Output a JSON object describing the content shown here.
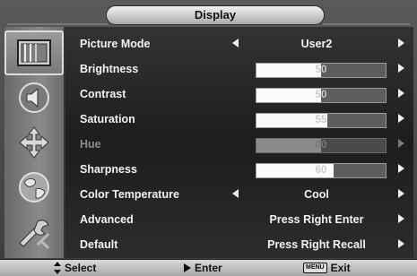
{
  "header": {
    "title": "Display"
  },
  "sidebar": {
    "icons": [
      {
        "name": "display-icon",
        "selected": true
      },
      {
        "name": "audio-icon",
        "selected": false
      },
      {
        "name": "position-icon",
        "selected": false
      },
      {
        "name": "globe-icon",
        "selected": false
      },
      {
        "name": "tools-icon",
        "selected": false
      }
    ]
  },
  "menu": {
    "picture_mode": {
      "label": "Picture Mode",
      "value": "User2"
    },
    "brightness": {
      "label": "Brightness",
      "value": "50",
      "level": 0.5
    },
    "contrast": {
      "label": "Contrast",
      "value": "50",
      "level": 0.5
    },
    "saturation": {
      "label": "Saturation",
      "value": "55",
      "level": 0.55
    },
    "hue": {
      "label": "Hue",
      "value": "00",
      "level": 0.5
    },
    "sharpness": {
      "label": "Sharpness",
      "value": "60",
      "level": 0.6
    },
    "color_temperature": {
      "label": "Color Temperature",
      "value": "Cool"
    },
    "advanced": {
      "label": "Advanced",
      "value": "Press Right Enter"
    },
    "default": {
      "label": "Default",
      "value": "Press Right Recall"
    }
  },
  "footer": {
    "select_label": "Select",
    "enter_label": "Enter",
    "menu_key": "MENU",
    "exit_label": "Exit"
  },
  "colors": {
    "panel": "#242424",
    "frame": "#4a4a4a",
    "bar_fill": "#fbfbfb",
    "footer": "#c4c4c4"
  }
}
